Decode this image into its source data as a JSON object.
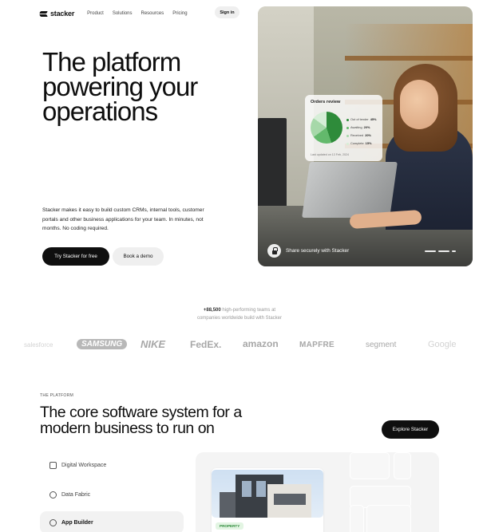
{
  "nav": {
    "logo": "stacker",
    "links": [
      "Product",
      "Solutions",
      "Resources",
      "Pricing"
    ],
    "signin": "Sign in"
  },
  "hero": {
    "title_lines": [
      "The platform",
      "powering your",
      "operations"
    ],
    "description": "Stacker makes it easy to build custom CRMs, internal tools, customer portals and other business applications for your team. In minutes, not months. No coding required.",
    "primary_cta": "Try Stacker for free",
    "secondary_cta": "Book a demo"
  },
  "hero_image": {
    "card_title": "Orders review",
    "legend": [
      {
        "label": "Out of tender",
        "value": "45%",
        "color": "#2e8b3a"
      },
      {
        "label": "Awaiting",
        "value": "20%",
        "color": "#63b96c"
      },
      {
        "label": "Received",
        "value": "20%",
        "color": "#a6d8a9"
      },
      {
        "label": "Complete",
        "value": "15%",
        "color": "#d6eed7"
      }
    ],
    "card_footer": "Last updated on 13 Feb, 2024",
    "share_text": "Share securely with Stacker"
  },
  "proof": {
    "count": "+88,500",
    "line1_rest": " high-performing teams at",
    "line2": "companies worldwide build with Stacker"
  },
  "brands": [
    "salesforce",
    "SAMSUNG",
    "NIKE",
    "FedEx.",
    "amazon",
    "MAPFRE",
    "segment",
    "Google"
  ],
  "platform": {
    "eyebrow": "THE PLATFORM",
    "title_lines": [
      "The core software system for a",
      "modern business to run on"
    ],
    "cta": "Explore Stacker",
    "features": [
      "Digital Workspace",
      "Data Fabric",
      "App Builder"
    ],
    "badge": "PROPERTY"
  }
}
